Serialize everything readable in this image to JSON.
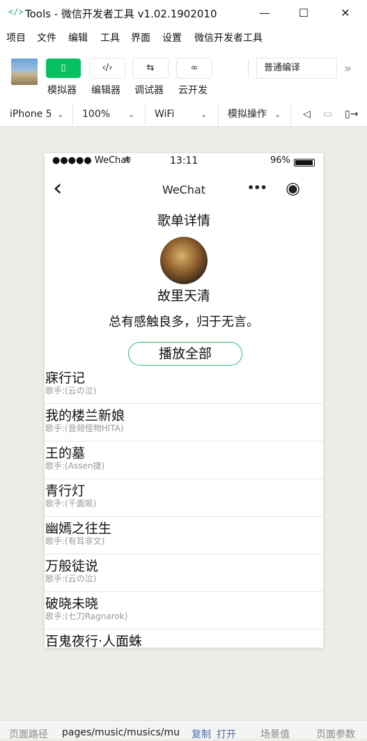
{
  "window": {
    "logo_glyph": "</>",
    "title": "Tools - 微信开发者工具 v1.02.1902010",
    "minimize_glyph": "—",
    "maximize_glyph": "☐",
    "close_glyph": "✕"
  },
  "menu": [
    "项目",
    "文件",
    "编辑",
    "工具",
    "界面",
    "设置",
    "微信开发者工具"
  ],
  "toolbar": {
    "buttons": [
      {
        "glyph": "▯",
        "label": "模拟器"
      },
      {
        "glyph": "‹/›",
        "label": "编辑器"
      },
      {
        "glyph": "⇆",
        "label": "调试器"
      },
      {
        "glyph": "∞",
        "label": "云开发"
      }
    ],
    "compile_mode": "普通编译",
    "more_glyph": "»"
  },
  "devbar": {
    "device": "iPhone 5",
    "zoom": "100%",
    "network": "WiFi",
    "simulate": "模拟操作",
    "caret": "⌄",
    "volume_glyph": "◁",
    "window_glyph": "▭",
    "exit_glyph": "▯→"
  },
  "phone": {
    "status": {
      "signal": "●●●●● WeChat",
      "wifi_glyph": "≋",
      "time": "13:11",
      "battery": "96%"
    },
    "nav": {
      "back_glyph": "‹",
      "title": "WeChat",
      "more_glyph": "•••",
      "record_glyph": "◉"
    },
    "page_title": "歌单详情",
    "creator": "故里天清",
    "description": "总有感触良多，归于无言。",
    "play_all": "播放全部",
    "songs": [
      {
        "name": "寐行记",
        "singer": "歌手:(云の泣)"
      },
      {
        "name": "我的楼兰新娘",
        "singer": "歌手:(音频怪物HITA)"
      },
      {
        "name": "王的墓",
        "singer": "歌手:(Assen捷)"
      },
      {
        "name": "青行灯",
        "singer": "歌手:(千面姬)"
      },
      {
        "name": "幽嫣之往生",
        "singer": "歌手:(有耳非文)"
      },
      {
        "name": "万般徒说",
        "singer": "歌手:(云の泣)"
      },
      {
        "name": "破晓未晓",
        "singer": "歌手:(七刀Ragnarok)"
      },
      {
        "name": "百鬼夜行·人面蛛",
        "singer": ""
      }
    ]
  },
  "bottom": {
    "path_label": "页面路径",
    "path_value": "pages/music/musics/mu",
    "copy": "复制",
    "open": "打开",
    "scene": "场景值",
    "params": "页面参数"
  },
  "colors": {
    "accent": "#07c160",
    "play_border": "#23c06f",
    "background": "#eeece7"
  }
}
